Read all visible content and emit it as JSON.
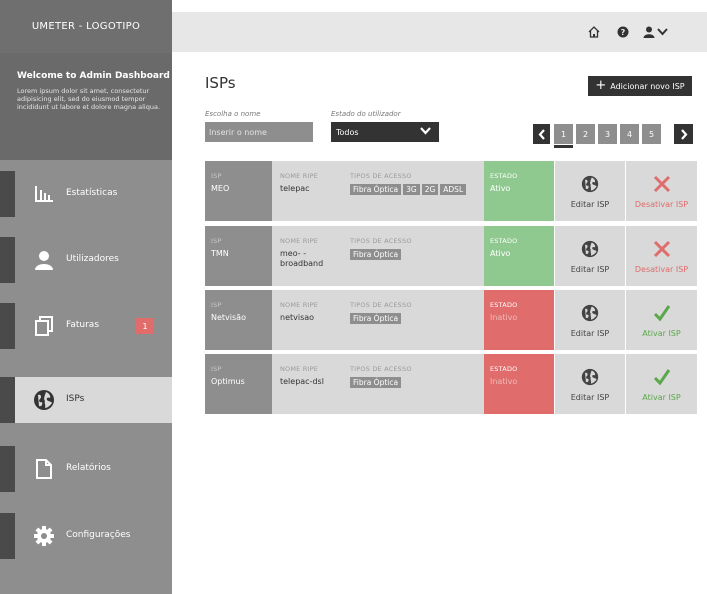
{
  "app": {
    "logo": "UMETER - LOGOTIPO"
  },
  "welcome": {
    "title": "Welcome to Admin Dashboard Josh,",
    "text": "Lorem ipsum dolor sit amet, consectetur adipisicing elit, sed do eiusmod tempor incididunt ut labore et dolore magna aliqua."
  },
  "sidebar": {
    "items": [
      {
        "label": "Estatísticas",
        "icon": "bar-chart-icon"
      },
      {
        "label": "Utilizadores",
        "icon": "user-icon"
      },
      {
        "label": "Faturas",
        "icon": "copy-icon",
        "badge": "1"
      },
      {
        "label": "ISPs",
        "icon": "globe-icon",
        "active": true
      },
      {
        "label": "Relatórios",
        "icon": "document-icon"
      },
      {
        "label": "Configurações",
        "icon": "gear-icon"
      }
    ]
  },
  "topbar": {
    "icons": [
      "home-icon",
      "help-icon",
      "user-icon",
      "chevron-down-icon"
    ]
  },
  "main": {
    "title": "ISPs",
    "add_button": "Adicionar novo ISP",
    "filter_name_label": "Escolha o nome",
    "filter_name_placeholder": "Inserir o nome",
    "filter_status_label": "Estado do utilizador",
    "filter_status_value": "Todos",
    "pages": [
      "1",
      "2",
      "3",
      "4",
      "5"
    ],
    "active_page": "1"
  },
  "table": {
    "labels": {
      "isp": "ISP",
      "ripe": "NOME RIPE",
      "tipos": "TIPOS DE ACESSO",
      "estado": "ESTADO"
    },
    "edit_label": "Editar ISP",
    "rows": [
      {
        "isp": "MEO",
        "ripe": "telepac",
        "tipos": [
          "Fibra Óptica",
          "3G",
          "2G",
          "ADSL"
        ],
        "estado": "Ativo",
        "action": "Desativar ISP"
      },
      {
        "isp": "TMN",
        "ripe": "meo- -broadband",
        "tipos": [
          "Fibra Óptica"
        ],
        "estado": "Ativo",
        "action": "Desativar ISP"
      },
      {
        "isp": "Netvisão",
        "ripe": "netvisao",
        "tipos": [
          "Fibra Óptica"
        ],
        "estado": "Inativo",
        "action": "Ativar ISP"
      },
      {
        "isp": "Optimus",
        "ripe": "telepac-dsl",
        "tipos": [
          "Fibra Óptica"
        ],
        "estado": "Inativo",
        "action": "Ativar ISP"
      }
    ]
  },
  "colors": {
    "active": "#8fc98f",
    "inactive": "#e06c6c",
    "sidebar": "#8e8e8e",
    "dark": "#333333"
  }
}
